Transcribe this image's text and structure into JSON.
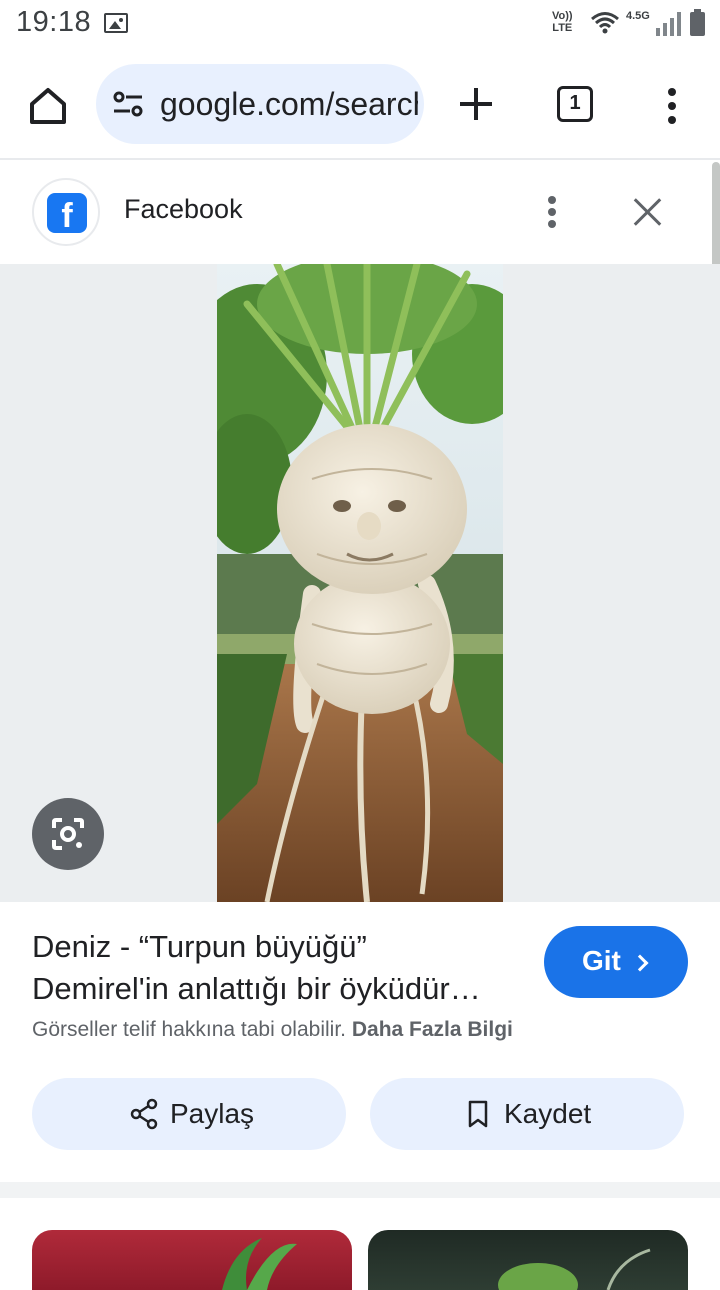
{
  "status_bar": {
    "time": "19:18",
    "volte_top": "Vo))",
    "volte_bottom": "LTE",
    "network": "4.5G"
  },
  "browser": {
    "url": "google.com/search",
    "tab_count": "1"
  },
  "source": {
    "name": "Facebook"
  },
  "result": {
    "title_line1": "Deniz - “Turpun büyüğü”",
    "title_line2": "Demirel'in anlattığı bir öyküdür…",
    "visit_label": "Git",
    "copyright_notice": "Görseller telif hakkına tabi olabilir.",
    "learn_more": "Daha Fazla Bilgi",
    "share_label": "Paylaş",
    "save_label": "Kaydet"
  },
  "colors": {
    "accent": "#1a73e8",
    "chip_bg": "#e8f0fe",
    "facebook": "#1877f2"
  }
}
